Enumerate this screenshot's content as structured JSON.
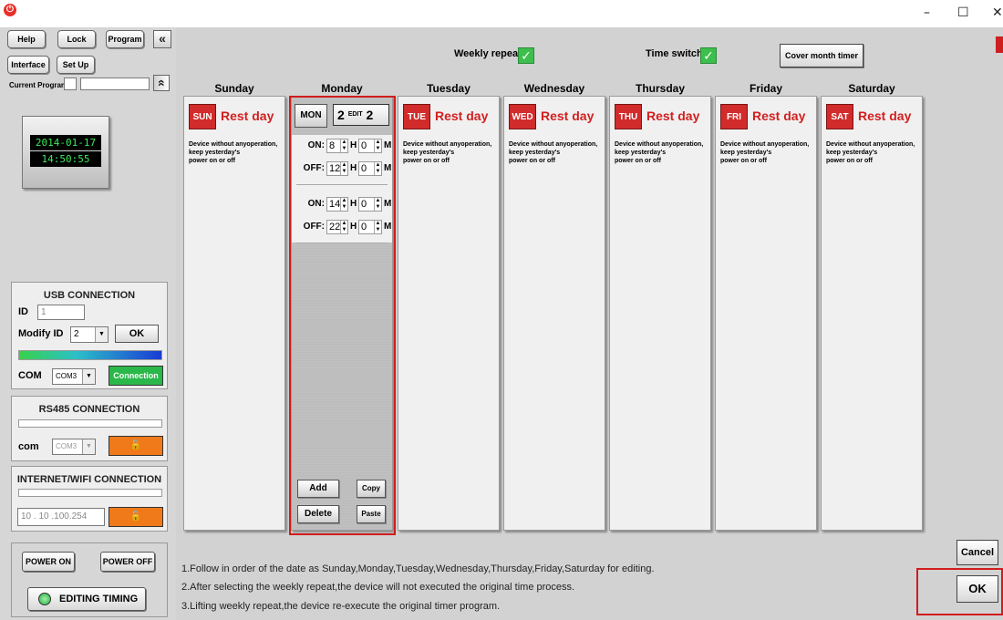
{
  "window": {
    "minimize": "–",
    "maximize": "☐",
    "close": "✕",
    "app_icon": "power-icon"
  },
  "toolbar": {
    "help": "Help",
    "lock": "Lock",
    "program": "Program",
    "collapse": "«",
    "interface": "Interface",
    "setup": "Set Up",
    "current_program_label": "Current Program",
    "expand": "«"
  },
  "clock": {
    "date": "2014-01-17",
    "time": "14:50:55"
  },
  "usb": {
    "title": "USB CONNECTION",
    "id_label": "ID",
    "id_value": "1",
    "modify_label": "Modify ID",
    "modify_value": "2",
    "ok": "OK",
    "com_label": "COM",
    "com_value": "COM3",
    "connection": "Connection"
  },
  "rs485": {
    "title": "RS485 CONNECTION",
    "com_label": "com",
    "com_value": "COM3"
  },
  "wifi": {
    "title": "INTERNET/WIFI CONNECTION",
    "ip": "10 . 10 .100.254"
  },
  "power": {
    "on": "POWER ON",
    "off": "POWER OFF",
    "editing": "EDITING TIMING"
  },
  "options": {
    "weekly_repeat": "Weekly repeat",
    "time_switch": "Time switch",
    "cover_month": "Cover month timer",
    "weekly_repeat_checked": true,
    "time_switch_checked": true
  },
  "days": [
    {
      "name": "Sunday",
      "tag": "SUN",
      "status": "Rest day"
    },
    {
      "name": "Monday",
      "tag": "MON"
    },
    {
      "name": "Tuesday",
      "tag": "TUE",
      "status": "Rest day"
    },
    {
      "name": "Wednesday",
      "tag": "WED",
      "status": "Rest day"
    },
    {
      "name": "Thursday",
      "tag": "THU",
      "status": "Rest day"
    },
    {
      "name": "Friday",
      "tag": "FRI",
      "status": "Rest day"
    },
    {
      "name": "Saturday",
      "tag": "SAT",
      "status": "Rest day"
    }
  ],
  "rest_desc": {
    "line1": "Device without anyoperation,",
    "line2": "keep yesterday's",
    "line3": "power on or off"
  },
  "monday": {
    "edit_left": "2",
    "edit_mid": "EDIT",
    "edit_right": "2",
    "on_label": "ON:",
    "off_label": "OFF:",
    "h": "H",
    "m": "M",
    "slots": [
      {
        "on_h": "8",
        "on_m": "0",
        "off_h": "12",
        "off_m": "0"
      },
      {
        "on_h": "14",
        "on_m": "0",
        "off_h": "22",
        "off_m": "0"
      }
    ],
    "add": "Add",
    "copy": "Copy",
    "delete": "Delete",
    "paste": "Paste"
  },
  "notes": [
    "1.Follow in order of the date as Sunday,Monday,Tuesday,Wednesday,Thursday,Friday,Saturday for editing.",
    "2.After selecting the weekly repeat,the device will not executed the original time process.",
    "3.Lifting weekly repeat,the device re-execute the original timer program."
  ],
  "dialog": {
    "cancel": "Cancel",
    "ok": "OK"
  },
  "colors": {
    "accent_red": "#d21c1c",
    "ok_green": "#2ab84a",
    "lock_orange": "#f07a1a",
    "clock_green": "#3ee85a"
  }
}
